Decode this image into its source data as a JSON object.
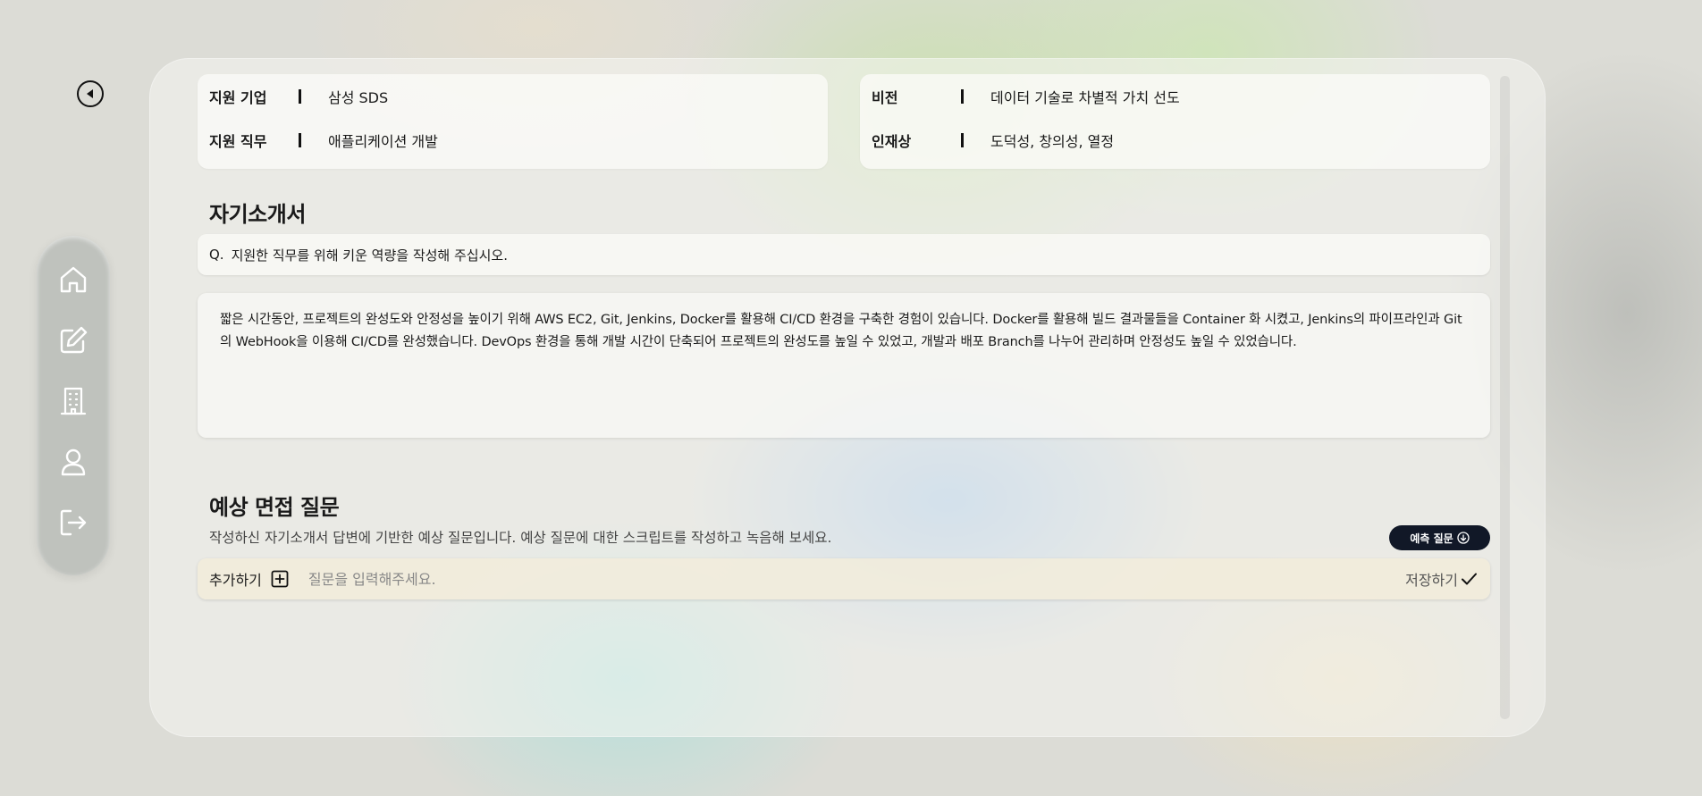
{
  "icons": {
    "back": "back-circle-icon",
    "home": "home-icon",
    "edit": "edit-icon",
    "company": "building-icon",
    "profile": "user-icon",
    "logout": "logout-icon",
    "add": "plus-square-icon",
    "save": "check-icon",
    "predict": "arrow-down-circle-icon"
  },
  "company_info": {
    "left": [
      {
        "label": "지원 기업",
        "value": "삼성 SDS"
      },
      {
        "label": "지원 직무",
        "value": "애플리케이션 개발"
      }
    ],
    "right": [
      {
        "label": "비전",
        "value": "데이터 기술로 차별적 가치 선도"
      },
      {
        "label": "인재상",
        "value": "도덕성, 창의성, 열정"
      }
    ]
  },
  "cover_letter": {
    "title": "자기소개서",
    "question_prefix": "Q.",
    "question": "지원한 직무를 위해 키운 역량을 작성해 주십시오.",
    "answer": "짧은 시간동안, 프로젝트의 완성도와 안정성을 높이기 위해 AWS EC2, Git, Jenkins, Docker를 활용해 CI/CD 환경을 구축한 경험이 있습니다. Docker를 활용해 빌드 결과물들을 Container 화 시켰고, Jenkins의 파이프라인과 Git의 WebHook을 이용해 CI/CD를 완성했습니다. DevOps 환경을 통해 개발 시간이 단축되어 프로젝트의 완성도를 높일 수 있었고, 개발과 배포 Branch를 나누어 관리하며 안정성도 높일 수 있었습니다."
  },
  "interview": {
    "title": "예상 면접 질문",
    "subtitle": "작성하신 자기소개서 답변에 기반한 예상 질문입니다. 예상 질문에 대한 스크립트를 작성하고 녹음해 보세요.",
    "predict_button": "예측 질문",
    "add_label": "추가하기",
    "input_placeholder": "질문을 입력해주세요.",
    "input_value": "",
    "save_label": "저장하기"
  },
  "colors": {
    "primary_dark": "#111827",
    "panel": "#f5f6f2",
    "add_bar": "#f2ecda"
  }
}
